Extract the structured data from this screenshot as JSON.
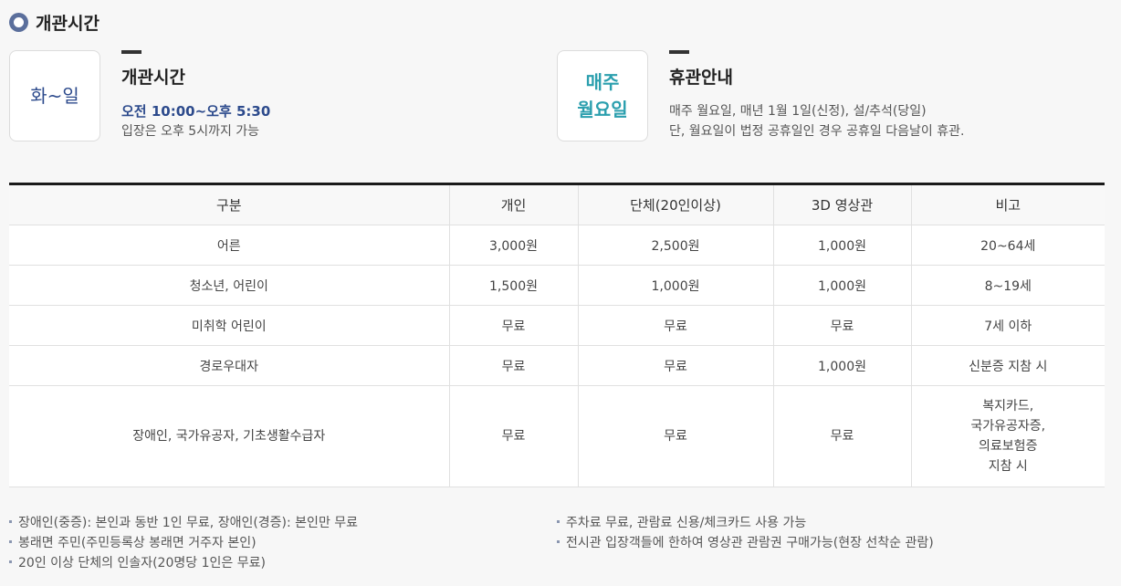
{
  "section_title": "개관시간",
  "hours_card": {
    "box_label": "화~일",
    "heading": "개관시간",
    "time": "오전 10:00~오후 5:30",
    "note": "입장은 오후 5시까지 가능"
  },
  "closed_card": {
    "box_line1": "매주",
    "box_line2": "월요일",
    "heading": "휴관안내",
    "line1": "매주 월요일, 매년 1월 1일(신정), 설/추석(당일)",
    "line2": "단, 월요일이 법정 공휴일인 경우 공휴일 다음날이 휴관."
  },
  "fee_table": {
    "headers": [
      "구분",
      "개인",
      "단체(20인이상)",
      "3D 영상관",
      "비고"
    ],
    "rows": [
      [
        "어른",
        "3,000원",
        "2,500원",
        "1,000원",
        "20~64세"
      ],
      [
        "청소년, 어린이",
        "1,500원",
        "1,000원",
        "1,000원",
        "8~19세"
      ],
      [
        "미취학 어린이",
        "무료",
        "무료",
        "무료",
        "7세 이하"
      ],
      [
        "경로우대자",
        "무료",
        "무료",
        "1,000원",
        "신분증 지참 시"
      ],
      [
        "장애인, 국가유공자, 기초생활수급자",
        "무료",
        "무료",
        "무료",
        ""
      ]
    ],
    "last_row_note_lines": [
      "복지카드,",
      "국가유공자증,",
      "의료보험증",
      "지참 시"
    ]
  },
  "notes_left": [
    "장애인(중증): 본인과 동반 1인 무료, 장애인(경증): 본인만 무료",
    "봉래면 주민(주민등록상 봉래면 거주자 본인)",
    "20인 이상 단체의 인솔자(20명당 1인은 무료)"
  ],
  "notes_right": [
    "주차료 무료, 관람료 신용/체크카드 사용 가능",
    "전시관 입장객들에 한하여 영상관 관람권 구매가능(현장 선착순 관람)"
  ]
}
